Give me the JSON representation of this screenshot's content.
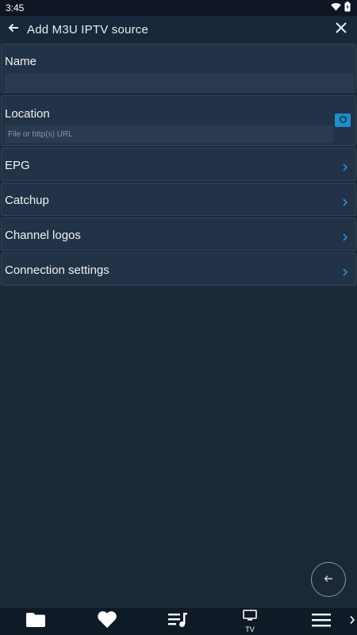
{
  "status_bar": {
    "time": "3:45",
    "icons": [
      "wifi-icon",
      "battery-icon"
    ]
  },
  "header": {
    "title": "Add M3U IPTV source",
    "back_icon": "arrow-left-icon",
    "close_icon": "close-icon"
  },
  "form": {
    "name": {
      "label": "Name",
      "value": "",
      "placeholder": ""
    },
    "location": {
      "label": "Location",
      "value": "",
      "placeholder": "File or http(s) URL",
      "action_icon": "refresh-icon"
    },
    "sections": [
      {
        "label": "EPG"
      },
      {
        "label": "Catchup"
      },
      {
        "label": "Channel logos"
      },
      {
        "label": "Connection settings"
      }
    ]
  },
  "fab": {
    "icon": "arrow-left-icon"
  },
  "bottom_nav": {
    "items": [
      {
        "icon": "folder-icon",
        "label": ""
      },
      {
        "icon": "heart-icon",
        "label": ""
      },
      {
        "icon": "playlist-icon",
        "label": ""
      },
      {
        "icon": "tv-icon",
        "label": "TV"
      },
      {
        "icon": "menu-icon",
        "label": ""
      }
    ],
    "more_icon": "chevron-right-icon"
  },
  "colors": {
    "background": "#1b2838",
    "card": "#223247",
    "accent": "#1d8cc9",
    "chevron": "#2f8fd0"
  }
}
